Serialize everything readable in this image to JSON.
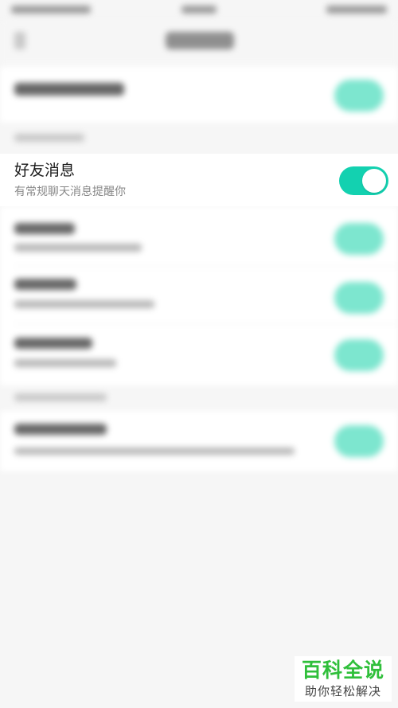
{
  "focused_setting": {
    "title": "好友消息",
    "subtitle": "有常规聊天消息提醒你",
    "toggle_on": true,
    "accent_color": "#13d1b0"
  },
  "watermark": {
    "main": "百科全说",
    "sub": "助你轻松解决"
  }
}
